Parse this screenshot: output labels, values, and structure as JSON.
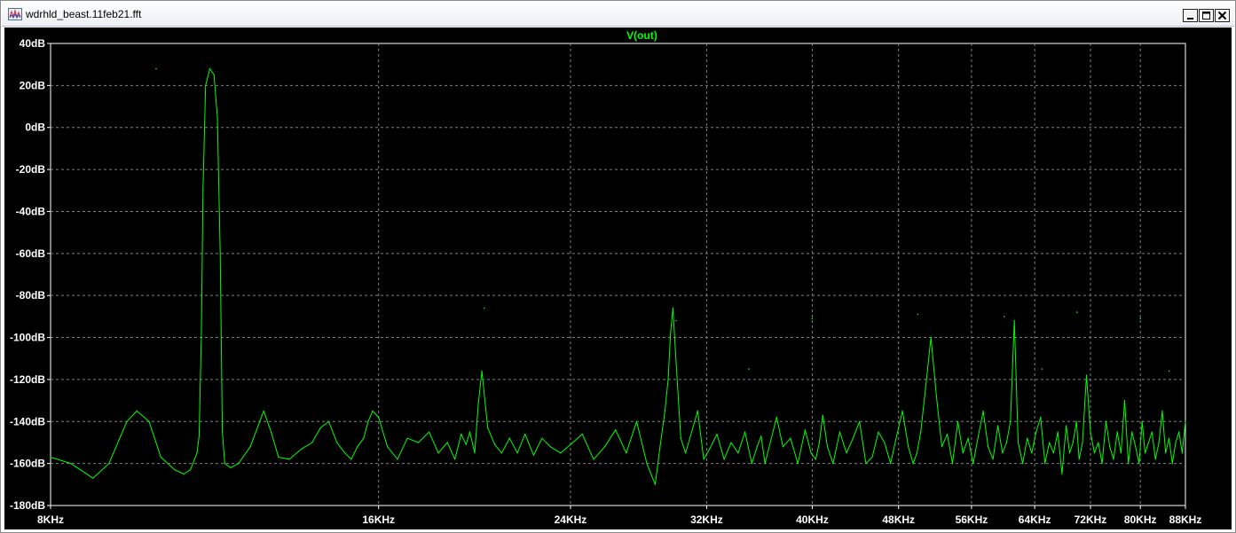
{
  "window": {
    "title": "wdrhld_beast.11feb21.fft",
    "controls": {
      "minimize": "minimize",
      "maximize": "maximize",
      "close": "close"
    }
  },
  "chart_data": {
    "type": "line",
    "title": "V(out)",
    "xlabel": "",
    "ylabel": "",
    "x_scale": "log",
    "xlim": [
      8000,
      88000
    ],
    "ylim": [
      -180,
      40
    ],
    "grid": true,
    "x_ticks": [
      {
        "value": 8000,
        "label": "8KHz"
      },
      {
        "value": 16000,
        "label": "16KHz"
      },
      {
        "value": 24000,
        "label": "24KHz"
      },
      {
        "value": 32000,
        "label": "32KHz"
      },
      {
        "value": 40000,
        "label": "40KHz"
      },
      {
        "value": 48000,
        "label": "48KHz"
      },
      {
        "value": 56000,
        "label": "56KHz"
      },
      {
        "value": 64000,
        "label": "64KHz"
      },
      {
        "value": 72000,
        "label": "72KHz"
      },
      {
        "value": 80000,
        "label": "80KHz"
      },
      {
        "value": 88000,
        "label": "88KHz"
      }
    ],
    "y_ticks": [
      {
        "value": 40,
        "label": "40dB"
      },
      {
        "value": 20,
        "label": "20dB"
      },
      {
        "value": 0,
        "label": "0dB"
      },
      {
        "value": -20,
        "label": "-20dB"
      },
      {
        "value": -40,
        "label": "-40dB"
      },
      {
        "value": -60,
        "label": "-60dB"
      },
      {
        "value": -80,
        "label": "-80dB"
      },
      {
        "value": -100,
        "label": "-100dB"
      },
      {
        "value": -120,
        "label": "-120dB"
      },
      {
        "value": -140,
        "label": "-140dB"
      },
      {
        "value": -160,
        "label": "-160dB"
      },
      {
        "value": -180,
        "label": "-180dB"
      }
    ],
    "colors": {
      "trace": "#00ff00",
      "background": "#000000",
      "axis_text": "#ffffff",
      "grid": "#808080"
    },
    "series": [
      {
        "name": "V(out)",
        "x": [
          8000,
          8350,
          8750,
          9050,
          9400,
          9600,
          9850,
          10100,
          10400,
          10600,
          10750,
          10900,
          10950,
          11000,
          11040,
          11100,
          11200,
          11300,
          11380,
          11450,
          11500,
          11560,
          11700,
          11900,
          12200,
          12550,
          12750,
          12950,
          13250,
          13600,
          13900,
          14150,
          14400,
          14650,
          14900,
          15100,
          15300,
          15500,
          15650,
          15800,
          16000,
          16300,
          16650,
          17000,
          17400,
          17800,
          18150,
          18500,
          18800,
          19050,
          19250,
          19400,
          19600,
          19750,
          19900,
          20150,
          20450,
          20750,
          21100,
          21450,
          21800,
          22200,
          22600,
          23000,
          23500,
          24000,
          24600,
          25200,
          25800,
          26400,
          27000,
          27600,
          28200,
          28700,
          29000,
          29300,
          29500,
          29650,
          29800,
          30000,
          30300,
          30600,
          31000,
          31400,
          31800,
          32200,
          32700,
          33200,
          33700,
          34200,
          34700,
          35200,
          35600,
          35900,
          36200,
          36600,
          37100,
          37600,
          38200,
          38800,
          39400,
          39900,
          40300,
          40600,
          40900,
          41300,
          41800,
          42400,
          43000,
          43600,
          44200,
          44800,
          45400,
          46000,
          46600,
          47200,
          47800,
          48400,
          49000,
          49500,
          49900,
          50300,
          50800,
          51400,
          52000,
          52600,
          53200,
          53800,
          54400,
          55000,
          55600,
          56200,
          56800,
          57400,
          58000,
          58600,
          59200,
          59800,
          60300,
          60800,
          61300,
          61800,
          62400,
          63000,
          63600,
          64200,
          64800,
          65400,
          66000,
          66600,
          67200,
          67800,
          68400,
          68900,
          69400,
          69900,
          70300,
          70800,
          71400,
          72000,
          72600,
          73200,
          73800,
          74400,
          75000,
          75600,
          76200,
          76800,
          77400,
          78000,
          78600,
          79200,
          79800,
          80300,
          80800,
          81400,
          82000,
          82600,
          83200,
          83800,
          84400,
          85000,
          85600,
          86200,
          86800,
          87400,
          88000
        ],
        "y": [
          -157,
          -160,
          -167,
          -160,
          -140,
          -135,
          -140,
          -157,
          -163,
          -165,
          -163,
          -155,
          -147,
          -100,
          -30,
          20,
          28,
          25,
          5,
          -60,
          -145,
          -160,
          -162,
          -160,
          -152,
          -135,
          -145,
          -157,
          -158,
          -153,
          -150,
          -143,
          -140,
          -150,
          -155,
          -158,
          -152,
          -148,
          -140,
          -135,
          -138,
          -152,
          -158,
          -148,
          -150,
          -145,
          -155,
          -150,
          -158,
          -146,
          -151,
          -145,
          -155,
          -132,
          -116,
          -143,
          -151,
          -155,
          -148,
          -155,
          -146,
          -156,
          -148,
          -152,
          -155,
          -151,
          -146,
          -158,
          -152,
          -144,
          -155,
          -140,
          -160,
          -170,
          -152,
          -135,
          -120,
          -98,
          -86,
          -112,
          -148,
          -155,
          -145,
          -135,
          -158,
          -153,
          -146,
          -158,
          -150,
          -155,
          -145,
          -160,
          -152,
          -147,
          -160,
          -150,
          -138,
          -152,
          -148,
          -160,
          -144,
          -155,
          -158,
          -150,
          -137,
          -152,
          -160,
          -145,
          -155,
          -148,
          -140,
          -160,
          -157,
          -145,
          -150,
          -160,
          -147,
          -135,
          -152,
          -160,
          -155,
          -145,
          -125,
          -100,
          -128,
          -152,
          -146,
          -160,
          -140,
          -155,
          -148,
          -160,
          -147,
          -135,
          -152,
          -158,
          -142,
          -155,
          -150,
          -140,
          -92,
          -150,
          -160,
          -148,
          -155,
          -145,
          -138,
          -160,
          -150,
          -155,
          -145,
          -165,
          -142,
          -155,
          -150,
          -140,
          -158,
          -150,
          -118,
          -145,
          -155,
          -150,
          -160,
          -140,
          -152,
          -158,
          -145,
          -155,
          -130,
          -160,
          -145,
          -152,
          -160,
          -140,
          -155,
          -150,
          -145,
          -158,
          -150,
          -135,
          -155,
          -148,
          -160,
          -150,
          -145,
          -155,
          -140
        ]
      }
    ],
    "peaks": [
      {
        "x": 10000,
        "y": 28
      },
      {
        "x": 20000,
        "y": -86
      },
      {
        "x": 30000,
        "y": -92
      },
      {
        "x": 35000,
        "y": -115
      },
      {
        "x": 40000,
        "y": -91
      },
      {
        "x": 50000,
        "y": -89
      },
      {
        "x": 60000,
        "y": -90
      },
      {
        "x": 65000,
        "y": -115
      },
      {
        "x": 70000,
        "y": -88
      },
      {
        "x": 80000,
        "y": -91
      },
      {
        "x": 85000,
        "y": -116
      }
    ]
  }
}
